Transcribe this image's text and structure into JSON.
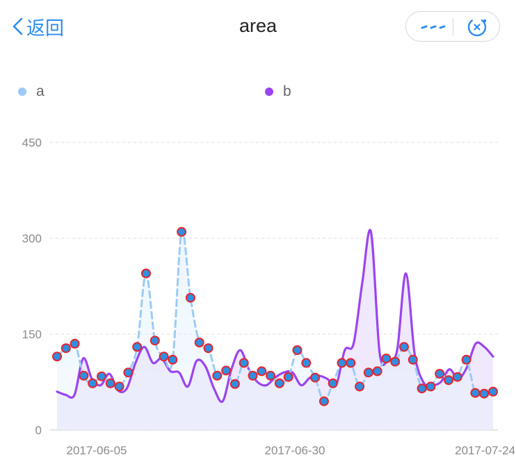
{
  "nav": {
    "back_label": "返回",
    "title": "area",
    "more_icon": "more-dots-icon",
    "close_icon": "capsule-close-icon"
  },
  "colors": {
    "accent": "#2a8cf0",
    "series_a": "#9ccbf5",
    "series_b": "#9a44ef",
    "point_fill": "#2f8fe0",
    "point_stroke": "#e8232d"
  },
  "chart_data": {
    "type": "area",
    "title": "",
    "x_tick_labels": [
      "2017-06-05",
      "2017-06-30",
      "2017-07-24"
    ],
    "y_ticks": [
      0,
      150,
      300,
      450
    ],
    "ylim": [
      0,
      450
    ],
    "x": [
      "2017-05-31",
      "2017-06-01",
      "2017-06-02",
      "2017-06-03",
      "2017-06-04",
      "2017-06-05",
      "2017-06-06",
      "2017-06-07",
      "2017-06-08",
      "2017-06-09",
      "2017-06-10",
      "2017-06-11",
      "2017-06-12",
      "2017-06-13",
      "2017-06-14",
      "2017-06-15",
      "2017-06-16",
      "2017-06-17",
      "2017-06-18",
      "2017-06-19",
      "2017-06-20",
      "2017-06-21",
      "2017-06-22",
      "2017-06-23",
      "2017-06-24",
      "2017-06-25",
      "2017-06-26",
      "2017-06-27",
      "2017-06-28",
      "2017-06-29",
      "2017-06-30",
      "2017-07-01",
      "2017-07-02",
      "2017-07-03",
      "2017-07-04",
      "2017-07-05",
      "2017-07-06",
      "2017-07-07",
      "2017-07-08",
      "2017-07-09",
      "2017-07-10",
      "2017-07-11",
      "2017-07-12",
      "2017-07-13",
      "2017-07-14",
      "2017-07-15",
      "2017-07-16",
      "2017-07-17",
      "2017-07-18",
      "2017-07-19",
      "2017-07-20",
      "2017-07-21",
      "2017-07-22",
      "2017-07-23",
      "2017-07-24",
      "2017-07-25"
    ],
    "series": [
      {
        "name": "a",
        "style": "dashed",
        "markers": true,
        "values": [
          115,
          128,
          135,
          85,
          73,
          84,
          73,
          68,
          90,
          130,
          245,
          140,
          115,
          110,
          310,
          207,
          137,
          128,
          85,
          93,
          72,
          105,
          85,
          92,
          85,
          73,
          83,
          125,
          105,
          82,
          45,
          73,
          105,
          105,
          68,
          90,
          92,
          112,
          107,
          130,
          110,
          65,
          68,
          88,
          78,
          83,
          110,
          58,
          57,
          60
        ]
      },
      {
        "name": "b",
        "style": "solid",
        "markers": false,
        "values": [
          60,
          55,
          55,
          112,
          80,
          70,
          88,
          62,
          65,
          105,
          130,
          105,
          112,
          92,
          90,
          68,
          108,
          100,
          65,
          45,
          95,
          125,
          95,
          75,
          70,
          82,
          90,
          90,
          70,
          82,
          85,
          80,
          70,
          125,
          135,
          230,
          310,
          120,
          110,
          125,
          245,
          120,
          75,
          70,
          75,
          95,
          80,
          98,
          135,
          130,
          115
        ]
      }
    ],
    "grid": true,
    "legend_position": "top"
  },
  "legend": [
    {
      "label": "a",
      "color": "#9ccbf5"
    },
    {
      "label": "b",
      "color": "#9a44ef"
    }
  ]
}
